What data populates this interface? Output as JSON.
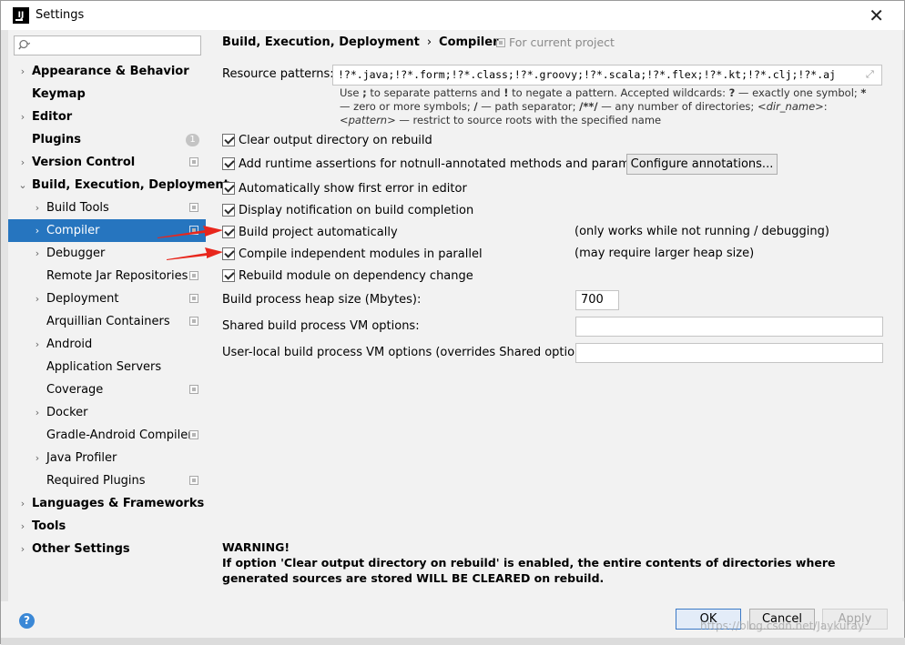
{
  "window": {
    "title": "Settings",
    "app_icon": "intellij-idea-icon",
    "close_glyph": "✕"
  },
  "sidebar": {
    "search": {
      "value": "",
      "placeholder": ""
    },
    "items": [
      {
        "label": "Appearance & Behavior",
        "level": 0,
        "bold": true,
        "arrow": "›",
        "project_icon": false,
        "badge": ""
      },
      {
        "label": "Keymap",
        "level": 0,
        "bold": true,
        "arrow": "",
        "project_icon": false,
        "badge": ""
      },
      {
        "label": "Editor",
        "level": 0,
        "bold": true,
        "arrow": "›",
        "project_icon": false,
        "badge": ""
      },
      {
        "label": "Plugins",
        "level": 0,
        "bold": true,
        "arrow": "",
        "project_icon": false,
        "badge": "1"
      },
      {
        "label": "Version Control",
        "level": 0,
        "bold": true,
        "arrow": "›",
        "project_icon": true,
        "badge": ""
      },
      {
        "label": "Build, Execution, Deployment",
        "level": 0,
        "bold": true,
        "arrow": "⌄",
        "project_icon": false,
        "badge": ""
      },
      {
        "label": "Build Tools",
        "level": 1,
        "bold": false,
        "arrow": "›",
        "project_icon": true,
        "badge": ""
      },
      {
        "label": "Compiler",
        "level": 1,
        "bold": false,
        "arrow": "›",
        "project_icon": true,
        "badge": "",
        "selected": true
      },
      {
        "label": "Debugger",
        "level": 1,
        "bold": false,
        "arrow": "›",
        "project_icon": false,
        "badge": ""
      },
      {
        "label": "Remote Jar Repositories",
        "level": 1,
        "bold": false,
        "arrow": "",
        "project_icon": true,
        "badge": ""
      },
      {
        "label": "Deployment",
        "level": 1,
        "bold": false,
        "arrow": "›",
        "project_icon": true,
        "badge": ""
      },
      {
        "label": "Arquillian Containers",
        "level": 1,
        "bold": false,
        "arrow": "",
        "project_icon": true,
        "badge": ""
      },
      {
        "label": "Android",
        "level": 1,
        "bold": false,
        "arrow": "›",
        "project_icon": false,
        "badge": ""
      },
      {
        "label": "Application Servers",
        "level": 1,
        "bold": false,
        "arrow": "",
        "project_icon": false,
        "badge": ""
      },
      {
        "label": "Coverage",
        "level": 1,
        "bold": false,
        "arrow": "",
        "project_icon": true,
        "badge": ""
      },
      {
        "label": "Docker",
        "level": 1,
        "bold": false,
        "arrow": "›",
        "project_icon": false,
        "badge": ""
      },
      {
        "label": "Gradle-Android Compiler",
        "level": 1,
        "bold": false,
        "arrow": "",
        "project_icon": true,
        "badge": ""
      },
      {
        "label": "Java Profiler",
        "level": 1,
        "bold": false,
        "arrow": "›",
        "project_icon": false,
        "badge": ""
      },
      {
        "label": "Required Plugins",
        "level": 1,
        "bold": false,
        "arrow": "",
        "project_icon": true,
        "badge": ""
      },
      {
        "label": "Languages & Frameworks",
        "level": 0,
        "bold": true,
        "arrow": "›",
        "project_icon": false,
        "badge": ""
      },
      {
        "label": "Tools",
        "level": 0,
        "bold": true,
        "arrow": "›",
        "project_icon": false,
        "badge": ""
      },
      {
        "label": "Other Settings",
        "level": 0,
        "bold": true,
        "arrow": "›",
        "project_icon": false,
        "badge": ""
      }
    ]
  },
  "main": {
    "breadcrumb": {
      "parent": "Build, Execution, Deployment",
      "separator": "›",
      "current": "Compiler"
    },
    "scope_hint": "For current project",
    "resource_patterns": {
      "label": "Resource patterns:",
      "value": "!?*.java;!?*.form;!?*.class;!?*.groovy;!?*.scala;!?*.flex;!?*.kt;!?*.clj;!?*.aj",
      "help_html": "Use <b>;</b> to separate patterns and <b>!</b> to negate a pattern. Accepted wildcards: <b>?</b> — exactly one symbol; <b>*</b> — zero or more symbols; <b>/</b> — path separator; <b>/**/</b> — any number of directories; <i>&lt;dir_name&gt;</i>:<i>&lt;pattern&gt;</i> — restrict to source roots with the specified name"
    },
    "options": [
      {
        "label": "Clear output directory on rebuild",
        "checked": true,
        "note": ""
      },
      {
        "label": "Add runtime assertions for notnull-annotated methods and parameters",
        "checked": true,
        "note": ""
      },
      {
        "label": "Automatically show first error in editor",
        "checked": true,
        "note": ""
      },
      {
        "label": "Display notification on build completion",
        "checked": true,
        "note": ""
      },
      {
        "label": "Build project automatically",
        "checked": true,
        "note": "(only works while not running / debugging)"
      },
      {
        "label": "Compile independent modules in parallel",
        "checked": true,
        "note": "(may require larger heap size)"
      },
      {
        "label": "Rebuild module on dependency change",
        "checked": true,
        "note": ""
      }
    ],
    "configure_button": "Configure annotations...",
    "heap_size": {
      "label": "Build process heap size (Mbytes):",
      "value": "700"
    },
    "shared_vm": {
      "label": "Shared build process VM options:",
      "value": ""
    },
    "user_vm": {
      "label": "User-local build process VM options (overrides Shared options):",
      "value": ""
    },
    "warning": {
      "title": "WARNING!",
      "text": "If option 'Clear output directory on rebuild' is enabled, the entire contents of directories where generated sources are stored WILL BE CLEARED on rebuild."
    }
  },
  "footer": {
    "help": "?",
    "ok": "OK",
    "cancel": "Cancel",
    "apply": "Apply"
  },
  "watermark": "https://blog.csdn.net/Jaykuray",
  "colors": {
    "selection": "#2675bf",
    "annotation_arrow": "#e8261c",
    "help_icon": "#3b88d6"
  }
}
